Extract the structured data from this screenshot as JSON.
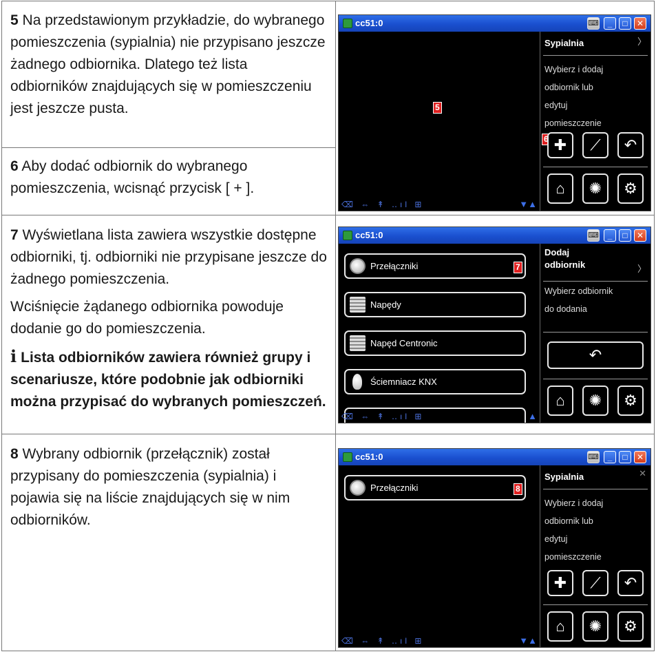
{
  "rows": [
    {
      "step": "5",
      "text": " Na przedstawionym przykładzie, do wybranego pomieszczenia (sypialnia) nie przypisano jeszcze żadnego odbiornika. Dlatego też lista odbiorników znajdujących się w pomieszczeniu jest jeszcze pusta."
    },
    {
      "step": "6",
      "text": " Aby dodać odbiornik do wybranego pomieszczenia, wcisnąć przycisk [ + ]."
    },
    {
      "step": "7",
      "text": " Wyświetlana lista zawiera wszystkie dostępne odbiorniki, tj. odbiorniki nie przypisane jeszcze do żadnego pomieszczenia.",
      "text2": "Wciśnięcie żądanego odbiornika powoduje dodanie go do pomieszczenia.",
      "note_icon": "i",
      "note": "Lista odbiorników zawiera również grupy i scenariusze, które podobnie jak odbiorniki można przypisać do wybranych pomieszczeń."
    },
    {
      "step": "8",
      "text": " Wybrany odbiornik (przełącznik) został przypisany do pomieszczenia (sypialnia) i pojawia się na liście znajdujących się w nim odbiorników."
    }
  ],
  "window_title": "cc51:0",
  "shot1": {
    "side_title": "Sypialnia",
    "side_text": [
      "Wybierz i dodaj",
      "odbiornik lub",
      "edytuj",
      "pomieszczenie"
    ],
    "marker_main": "5",
    "marker_add": "6"
  },
  "shot2": {
    "side_title_1": "Dodaj",
    "side_title_2": "odbiornik",
    "side_text": [
      "Wybierz odbiornik",
      "do dodania"
    ],
    "marker": "7",
    "items": [
      "Przełączniki",
      "Napędy",
      "Napęd Centronic",
      "Ściemniacz KNX"
    ]
  },
  "shot3": {
    "side_title": "Sypialnia",
    "side_text": [
      "Wybierz i dodaj",
      "odbiornik lub",
      "edytuj",
      "pomieszczenie"
    ],
    "marker": "8",
    "item": "Przełączniki"
  },
  "glyphs": {
    "plus": "✚",
    "wrench": "⟋",
    "back": "↶",
    "home": "⌂",
    "fan": "✺",
    "gear": "⚙",
    "status": "⌫ ⇔ ↟ ‥ıl ⊞",
    "scroll_down_up": "▼▲",
    "scroll_up": "▲",
    "kbd": "⌨",
    "min": "_",
    "max": "□",
    "close": "✕",
    "chev": "〉",
    "close_x": "✕"
  }
}
